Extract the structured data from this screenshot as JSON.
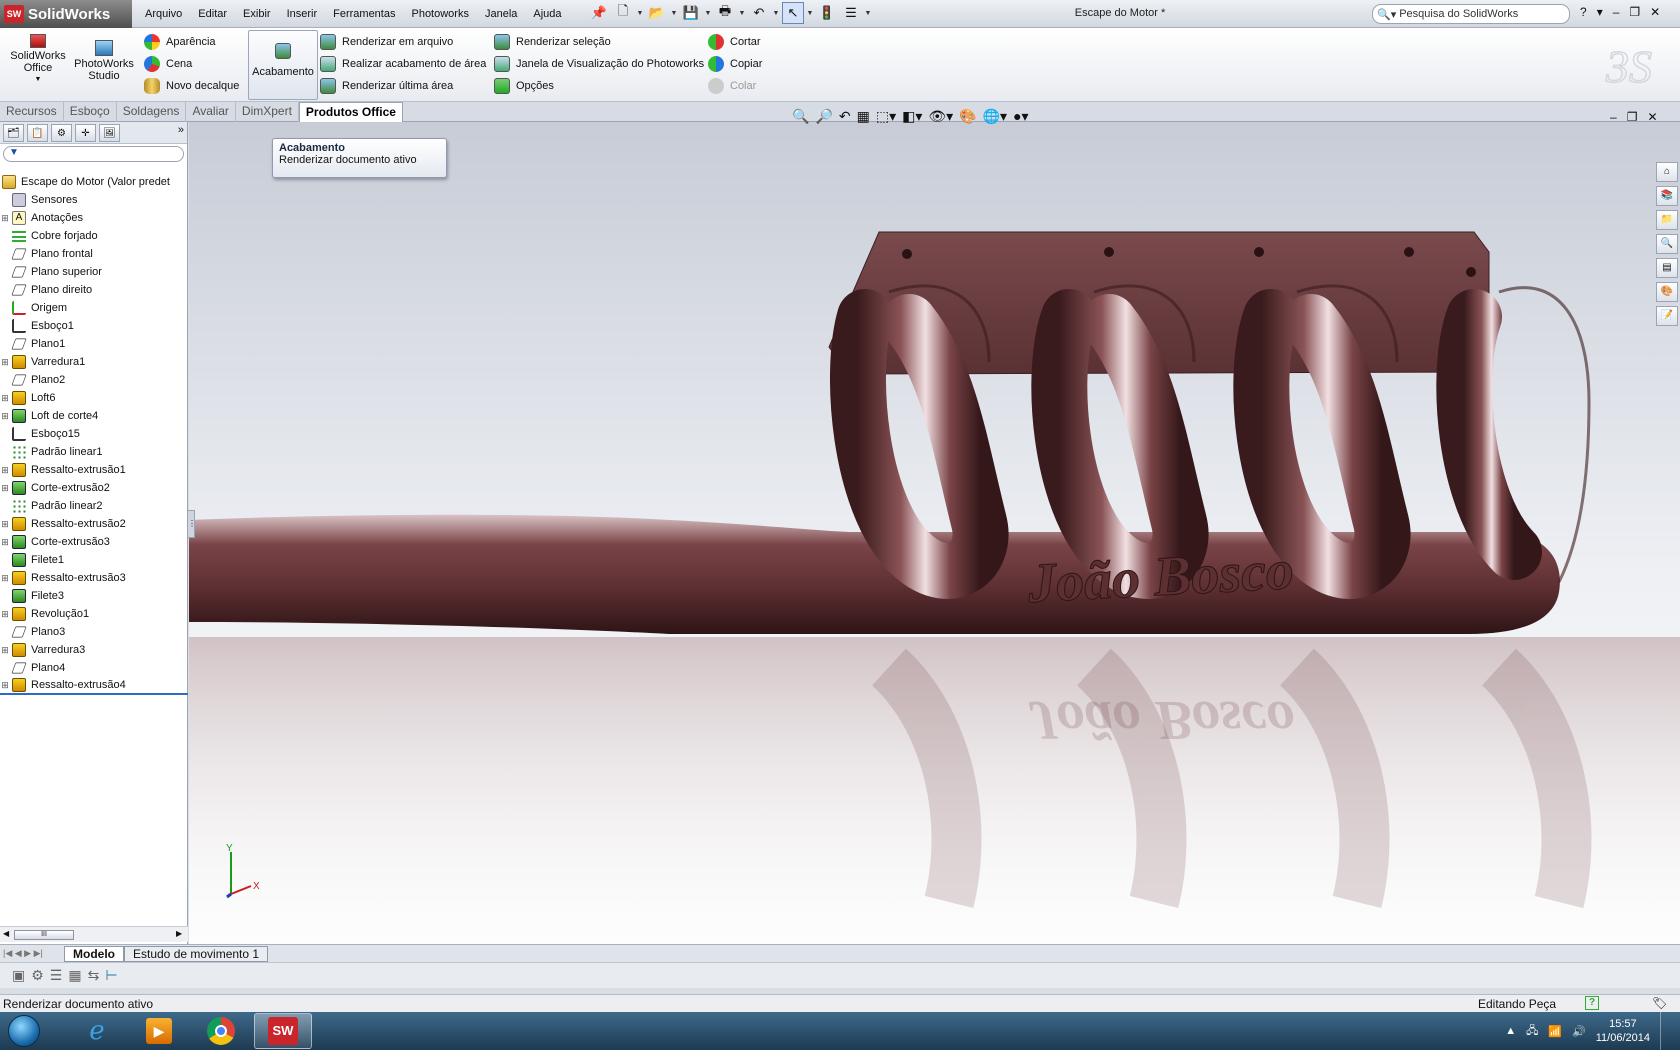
{
  "app": {
    "brand": "SolidWorks",
    "window_title": "Escape do Motor *"
  },
  "menu": [
    "Arquivo",
    "Editar",
    "Exibir",
    "Inserir",
    "Ferramentas",
    "Photoworks",
    "Janela",
    "Ajuda"
  ],
  "search": {
    "placeholder": "Pesquisa do SolidWorks"
  },
  "ribbon": {
    "sw_office": "SolidWorks Office",
    "photoworks_studio": "PhotoWorks Studio",
    "col1": [
      "Aparência",
      "Cena",
      "Novo decalque"
    ],
    "acabamento": "Acabamento",
    "col2": [
      "Renderizar em arquivo",
      "Realizar acabamento de área",
      "Renderizar última área"
    ],
    "col3": [
      "Renderizar seleção",
      "Janela de Visualização do Photoworks",
      "Opções"
    ],
    "col4": [
      "Cortar",
      "Copiar",
      "Colar"
    ]
  },
  "tabs": [
    "Recursos",
    "Esboço",
    "Soldagens",
    "Avaliar",
    "DimXpert",
    "Produtos Office"
  ],
  "tooltip": {
    "title": "Acabamento",
    "text": "Renderizar documento ativo"
  },
  "tree": {
    "root": "Escape do Motor  (Valor predet",
    "items": [
      {
        "label": "Sensores",
        "icon": "sensor-icon",
        "exp": false
      },
      {
        "label": "Anotações",
        "icon": "annotation-icon",
        "exp": true
      },
      {
        "label": "Cobre forjado",
        "icon": "material-icon",
        "exp": false
      },
      {
        "label": "Plano frontal",
        "icon": "plane-icon",
        "exp": false
      },
      {
        "label": "Plano superior",
        "icon": "plane-icon",
        "exp": false
      },
      {
        "label": "Plano direito",
        "icon": "plane-icon",
        "exp": false
      },
      {
        "label": "Origem",
        "icon": "origin-icon",
        "exp": false
      },
      {
        "label": "Esboço1",
        "icon": "sketch-icon",
        "exp": false
      },
      {
        "label": "Plano1",
        "icon": "plane-icon",
        "exp": false
      },
      {
        "label": "Varredura1",
        "icon": "sweep-icon",
        "exp": true
      },
      {
        "label": "Plano2",
        "icon": "plane-icon",
        "exp": false
      },
      {
        "label": "Loft6",
        "icon": "loft-icon",
        "exp": true
      },
      {
        "label": "Loft de corte4",
        "icon": "cut-loft-icon",
        "exp": true
      },
      {
        "label": "Esboço15",
        "icon": "sketch-icon",
        "exp": false
      },
      {
        "label": "Padrão linear1",
        "icon": "pattern-icon",
        "exp": false
      },
      {
        "label": "Ressalto-extrusão1",
        "icon": "extrude-icon",
        "exp": true
      },
      {
        "label": "Corte-extrusão2",
        "icon": "cut-extrude-icon",
        "exp": true
      },
      {
        "label": "Padrão linear2",
        "icon": "pattern-icon",
        "exp": false
      },
      {
        "label": "Ressalto-extrusão2",
        "icon": "extrude-icon",
        "exp": true
      },
      {
        "label": "Corte-extrusão3",
        "icon": "cut-extrude-icon",
        "exp": true
      },
      {
        "label": "Filete1",
        "icon": "fillet-icon",
        "exp": false
      },
      {
        "label": "Ressalto-extrusão3",
        "icon": "extrude-icon",
        "exp": true
      },
      {
        "label": "Filete3",
        "icon": "fillet-icon",
        "exp": false
      },
      {
        "label": "Revolução1",
        "icon": "revolve-icon",
        "exp": true
      },
      {
        "label": "Plano3",
        "icon": "plane-icon",
        "exp": false
      },
      {
        "label": "Varredura3",
        "icon": "sweep-icon",
        "exp": true
      },
      {
        "label": "Plano4",
        "icon": "plane-icon",
        "exp": false
      },
      {
        "label": "Ressalto-extrusão4",
        "icon": "extrude-icon",
        "exp": true
      }
    ]
  },
  "scroll_thumb": "III",
  "model": {
    "engraving": "João Bosco",
    "color": "#6b3a3d",
    "highlight": "#f4e8ea"
  },
  "triad": {
    "y": "Y",
    "x": "X"
  },
  "bottom_tabs": [
    "Modelo",
    "Estudo de movimento 1"
  ],
  "status": {
    "left": "Renderizar documento ativo",
    "right": "Editando Peça",
    "help": "?"
  },
  "taskbar": {
    "time": "15:57",
    "date": "11/06/2014",
    "sw_label": "SW"
  }
}
